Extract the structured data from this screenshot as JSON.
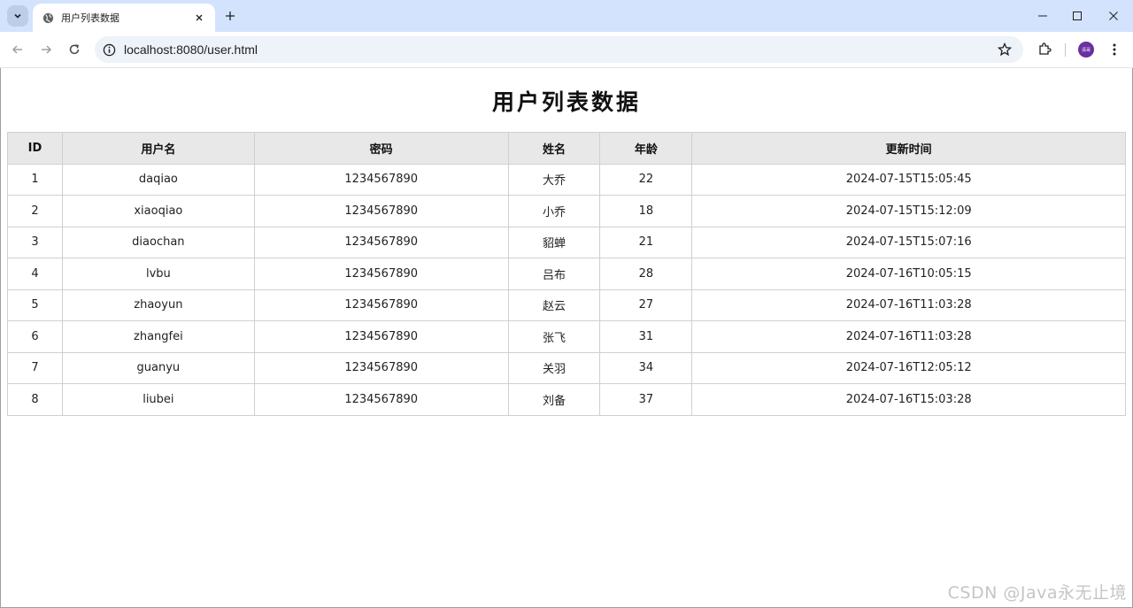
{
  "browser": {
    "tab_title": "用户列表数据",
    "url": "localhost:8080/user.html",
    "avatar_text": "清哥",
    "accent_color": "#d3e3fd"
  },
  "page": {
    "title": "用户列表数据",
    "columns": [
      "ID",
      "用户名",
      "密码",
      "姓名",
      "年龄",
      "更新时间"
    ],
    "rows": [
      {
        "id": "1",
        "username": "daqiao",
        "password": "1234567890",
        "name": "大乔",
        "age": "22",
        "updated": "2024-07-15T15:05:45"
      },
      {
        "id": "2",
        "username": "xiaoqiao",
        "password": "1234567890",
        "name": "小乔",
        "age": "18",
        "updated": "2024-07-15T15:12:09"
      },
      {
        "id": "3",
        "username": "diaochan",
        "password": "1234567890",
        "name": "貂蝉",
        "age": "21",
        "updated": "2024-07-15T15:07:16"
      },
      {
        "id": "4",
        "username": "lvbu",
        "password": "1234567890",
        "name": "吕布",
        "age": "28",
        "updated": "2024-07-16T10:05:15"
      },
      {
        "id": "5",
        "username": "zhaoyun",
        "password": "1234567890",
        "name": "赵云",
        "age": "27",
        "updated": "2024-07-16T11:03:28"
      },
      {
        "id": "6",
        "username": "zhangfei",
        "password": "1234567890",
        "name": "张飞",
        "age": "31",
        "updated": "2024-07-16T11:03:28"
      },
      {
        "id": "7",
        "username": "guanyu",
        "password": "1234567890",
        "name": "关羽",
        "age": "34",
        "updated": "2024-07-16T12:05:12"
      },
      {
        "id": "8",
        "username": "liubei",
        "password": "1234567890",
        "name": "刘备",
        "age": "37",
        "updated": "2024-07-16T15:03:28"
      }
    ]
  },
  "watermark": "CSDN @Java永无止境"
}
